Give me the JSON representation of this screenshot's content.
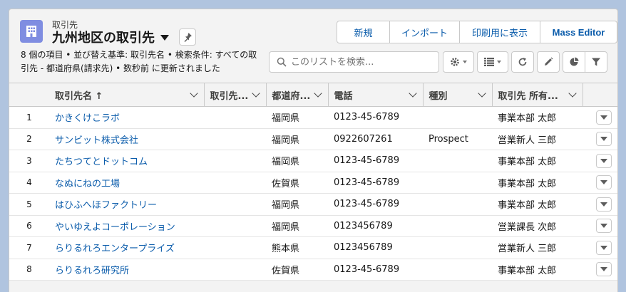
{
  "header": {
    "object_label": "取引先",
    "title": "九州地区の取引先",
    "summary": "8 個の項目 • 並び替え基準: 取引先名 • 検索条件: すべての取引先 - 都道府県(請求先) • 数秒前 に更新されました"
  },
  "actions": [
    "新規",
    "インポート",
    "印刷用に表示",
    "Mass Editor"
  ],
  "search": {
    "placeholder": "このリストを検索..."
  },
  "colors": {
    "accent": "#0b5cab",
    "object_icon": "#7f8de1",
    "background": "#b0c4df"
  },
  "table": {
    "columns": [
      "取引先名 ↑",
      "取引先...",
      "都道府...",
      "電話",
      "種別",
      "取引先 所有..."
    ],
    "rows": [
      {
        "num": "1",
        "name": "かきくけこラボ",
        "site": "",
        "pref": "福岡県",
        "phone": "0123-45-6789",
        "type": "",
        "owner": "事業本部 太郎"
      },
      {
        "num": "2",
        "name": "サンビット株式会社",
        "site": "",
        "pref": "福岡県",
        "phone": "0922607261",
        "type": "Prospect",
        "owner": "営業新人 三郎"
      },
      {
        "num": "3",
        "name": "たちつてとドットコム",
        "site": "",
        "pref": "福岡県",
        "phone": "0123-45-6789",
        "type": "",
        "owner": "事業本部 太郎"
      },
      {
        "num": "4",
        "name": "なぬにねの工場",
        "site": "",
        "pref": "佐賀県",
        "phone": "0123-45-6789",
        "type": "",
        "owner": "事業本部 太郎"
      },
      {
        "num": "5",
        "name": "はひふへほファクトリー",
        "site": "",
        "pref": "福岡県",
        "phone": "0123-45-6789",
        "type": "",
        "owner": "事業本部 太郎"
      },
      {
        "num": "6",
        "name": "やいゆえよコーポレーション",
        "site": "",
        "pref": "福岡県",
        "phone": "0123456789",
        "type": "",
        "owner": "営業課長 次郎"
      },
      {
        "num": "7",
        "name": "らりるれろエンタープライズ",
        "site": "",
        "pref": "熊本県",
        "phone": "0123456789",
        "type": "",
        "owner": "営業新人 三郎"
      },
      {
        "num": "8",
        "name": "らりるれろ研究所",
        "site": "",
        "pref": "佐賀県",
        "phone": "0123-45-6789",
        "type": "",
        "owner": "事業本部 太郎"
      }
    ]
  }
}
